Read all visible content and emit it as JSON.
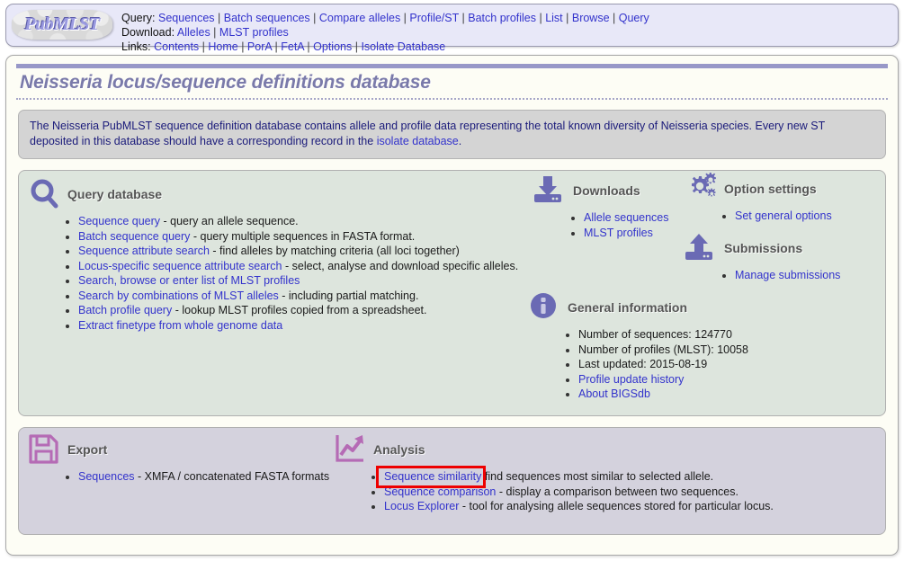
{
  "header": {
    "logo_text": "PubMLST",
    "rows": [
      {
        "label": "Query:",
        "items": [
          "Sequences",
          "Batch sequences",
          "Compare alleles",
          "Profile/ST",
          "Batch profiles",
          "List",
          "Browse",
          "Query"
        ]
      },
      {
        "label": "Download:",
        "items": [
          "Alleles",
          "MLST profiles"
        ]
      },
      {
        "label": "Links:",
        "items": [
          "Contents",
          "Home",
          "PorA",
          "FetA",
          "Options",
          "Isolate Database"
        ]
      }
    ]
  },
  "page": {
    "title": "Neisseria locus/sequence definitions database",
    "description_part1": "The Neisseria PubMLST sequence definition database contains allele and profile data representing the total known diversity of Neisseria species. Every new ST deposited in this database should have a corresponding record in the ",
    "description_link": "isolate database",
    "description_part2": "."
  },
  "query_database": {
    "title": "Query database",
    "icon": "magnifier-icon",
    "items": [
      {
        "link": "Sequence query",
        "desc": " - query an allele sequence."
      },
      {
        "link": "Batch sequence query",
        "desc": " - query multiple sequences in FASTA format."
      },
      {
        "link": "Sequence attribute search",
        "desc": " - find alleles by matching criteria (all loci together)"
      },
      {
        "link": "Locus-specific sequence attribute search",
        "desc": " - select, analyse and download specific alleles."
      },
      {
        "link": "Search, browse or enter list of MLST profiles",
        "desc": ""
      },
      {
        "link": "Search by combinations of MLST alleles",
        "desc": " - including partial matching."
      },
      {
        "link": "Batch profile query",
        "desc": " - lookup MLST profiles copied from a spreadsheet."
      },
      {
        "link": "Extract finetype from whole genome data",
        "desc": ""
      }
    ]
  },
  "downloads": {
    "title": "Downloads",
    "icon": "download-icon",
    "items": [
      {
        "link": "Allele sequences",
        "desc": ""
      },
      {
        "link": "MLST profiles",
        "desc": ""
      }
    ]
  },
  "option_settings": {
    "title": "Option settings",
    "icon": "gear-icon",
    "items": [
      {
        "link": "Set general options",
        "desc": ""
      }
    ]
  },
  "submissions": {
    "title": "Submissions",
    "icon": "upload-icon",
    "items": [
      {
        "link": "Manage submissions",
        "desc": ""
      }
    ]
  },
  "general_information": {
    "title": "General information",
    "icon": "info-icon",
    "items": [
      {
        "link": "",
        "desc": "Number of sequences: 124770"
      },
      {
        "link": "",
        "desc": "Number of profiles (MLST): 10058"
      },
      {
        "link": "",
        "desc": "Last updated: 2015-08-19"
      },
      {
        "link": "Profile update history",
        "desc": ""
      },
      {
        "link": "About BIGSdb",
        "desc": ""
      }
    ]
  },
  "export": {
    "title": "Export",
    "icon": "floppy-disk-icon",
    "items": [
      {
        "link": "Sequences",
        "desc": " - XMFA / concatenated FASTA formats"
      }
    ]
  },
  "analysis": {
    "title": "Analysis",
    "icon": "chart-up-icon",
    "items": [
      {
        "link": "Sequence similarity",
        "desc": " find sequences most similar to selected allele.",
        "highlighted": true
      },
      {
        "link": "Sequence comparison",
        "desc": " - display a comparison between two sequences.",
        "highlighted": false
      },
      {
        "link": "Locus Explorer",
        "desc": " - tool for analysing allele sequences stored for particular locus.",
        "highlighted": false
      }
    ]
  },
  "colors": {
    "link": "#3333cc",
    "icon_purple": "#6a6ab4",
    "icon_magenta": "#b56bb5",
    "highlight_red": "#ee0000",
    "panel_green": "#dde5dd",
    "panel_purple": "#d4d2dd",
    "header_bg": "#e8e8f8",
    "title_purple": "#7a7aaa"
  }
}
